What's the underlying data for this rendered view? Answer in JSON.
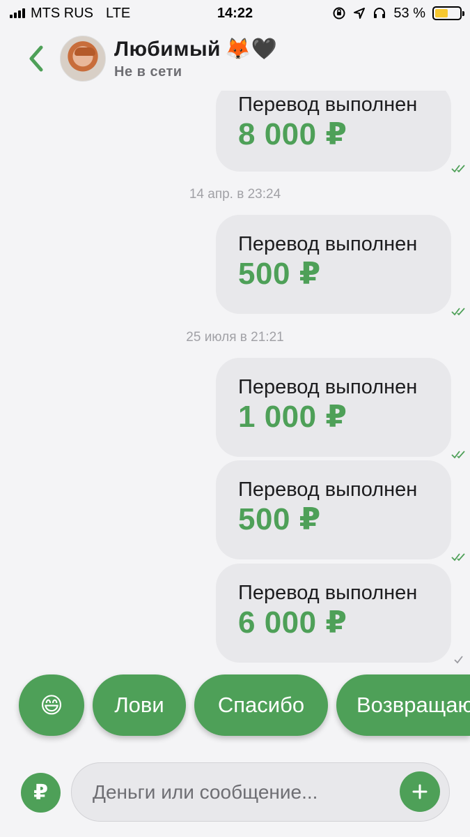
{
  "status_bar": {
    "carrier": "MTS RUS",
    "network": "LTE",
    "time": "14:22",
    "battery": "53 %",
    "battery_level": 0.53,
    "battery_color": "#f7c830"
  },
  "header": {
    "back_icon": "chevron-left-icon",
    "contact_name": "Любимый",
    "name_emojis": "🦊🖤",
    "status": "Не в сети"
  },
  "messages": [
    {
      "title": "Перевод выполнен",
      "amount": "8 000 ₽",
      "read": true
    },
    {
      "title": "Перевод выполнен",
      "amount": "500 ₽",
      "read": true
    },
    {
      "title": "Перевод выполнен",
      "amount": "1 000 ₽",
      "read": true
    },
    {
      "title": "Перевод выполнен",
      "amount": "500 ₽",
      "read": true
    },
    {
      "title": "Перевод выполнен",
      "amount": "6 000 ₽",
      "read": false
    }
  ],
  "dates": [
    "14 апр. в 23:24",
    "25 июля в 21:21"
  ],
  "quick_replies": {
    "emoji": "😄",
    "items": [
      "Лови",
      "Спасибо",
      "Возвращаю"
    ]
  },
  "input": {
    "ruble_label": "₽",
    "placeholder": "Деньги или сообщение...",
    "value": ""
  },
  "colors": {
    "accent": "#4ea058",
    "bubble": "#e8e8eb",
    "background": "#f4f4f6",
    "check_read": "#4ea058",
    "check_sent": "#9a9aa0"
  }
}
